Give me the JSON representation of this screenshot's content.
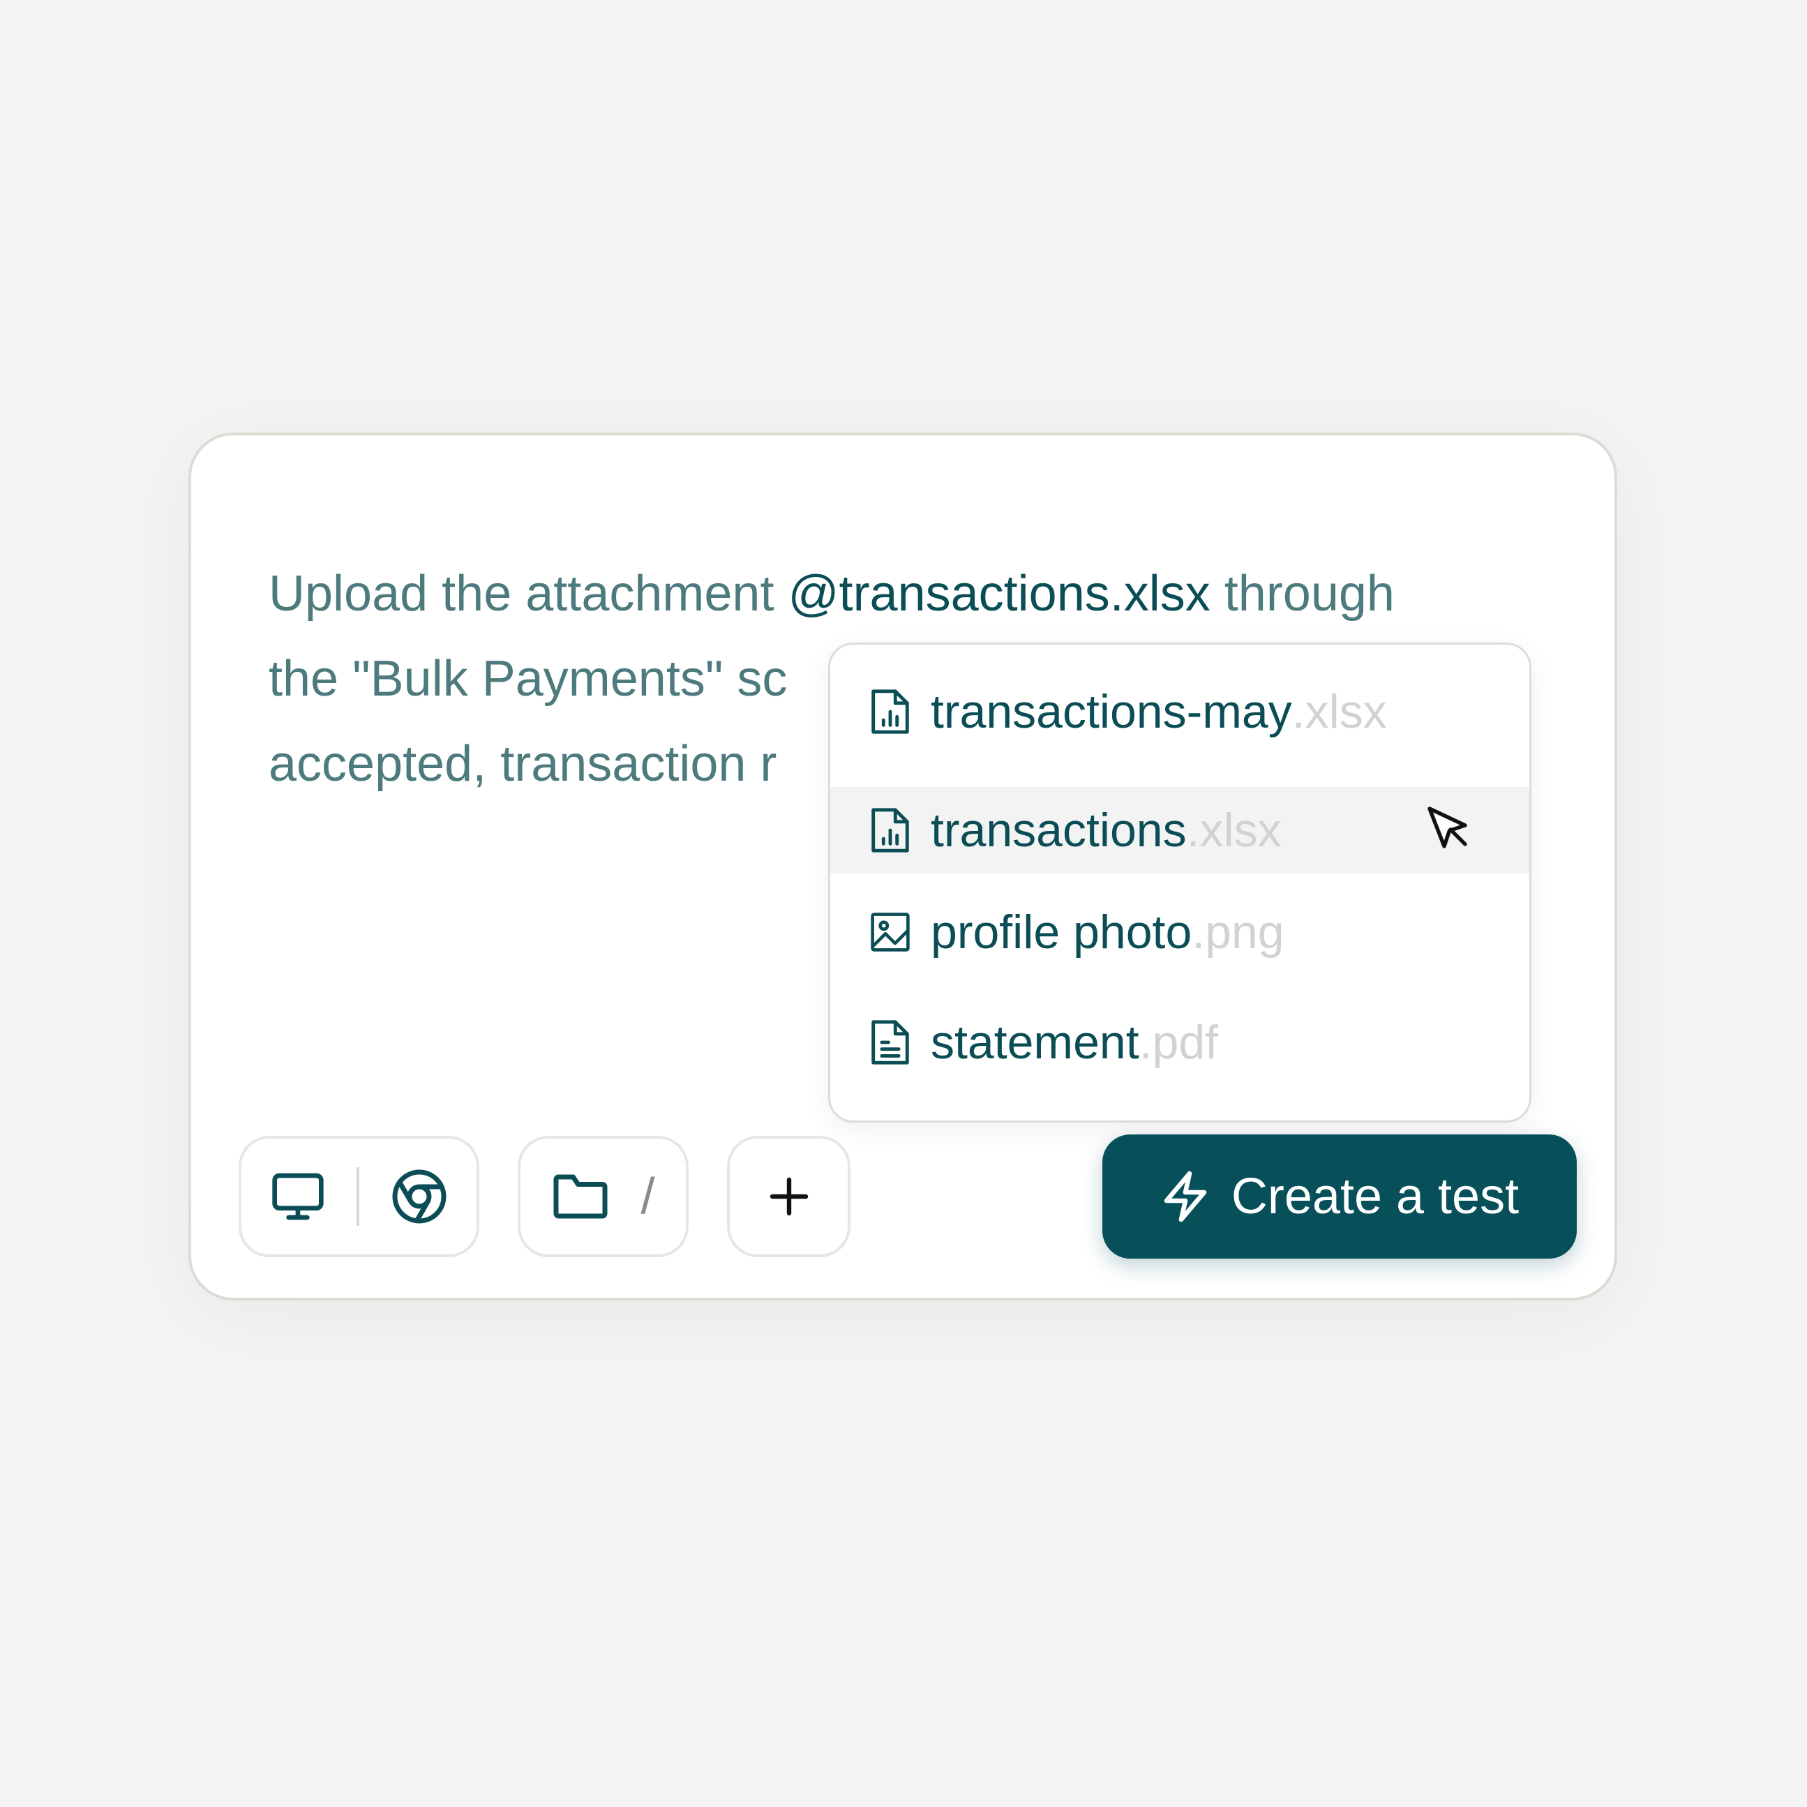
{
  "prompt": {
    "line1_before": "Upload the attachment ",
    "mention": "@transactions.xlsx",
    "line1_after": " through",
    "line2": "the \"Bulk Payments\" sc",
    "line3": "accepted, transaction r"
  },
  "dropdown": {
    "items": [
      {
        "name": "transactions-may",
        "ext": ".xlsx",
        "icon": "spreadsheet-file-icon"
      },
      {
        "name": "transactions",
        "ext": ".xlsx",
        "icon": "spreadsheet-file-icon",
        "active": true
      },
      {
        "name": "profile photo",
        "ext": ".png",
        "icon": "image-file-icon"
      },
      {
        "name": "statement",
        "ext": ".pdf",
        "icon": "document-file-icon"
      }
    ]
  },
  "toolbar": {
    "env_icons": [
      "desktop-icon",
      "chrome-icon"
    ],
    "folder_icon": "folder-icon",
    "folder_slash": "/",
    "add_icon": "plus-icon"
  },
  "create_button": {
    "label": "Create a test",
    "icon": "lightning-icon"
  },
  "colors": {
    "accent": "#07505a",
    "text_muted": "#4d7a7c",
    "background": "#f4f4f4"
  }
}
